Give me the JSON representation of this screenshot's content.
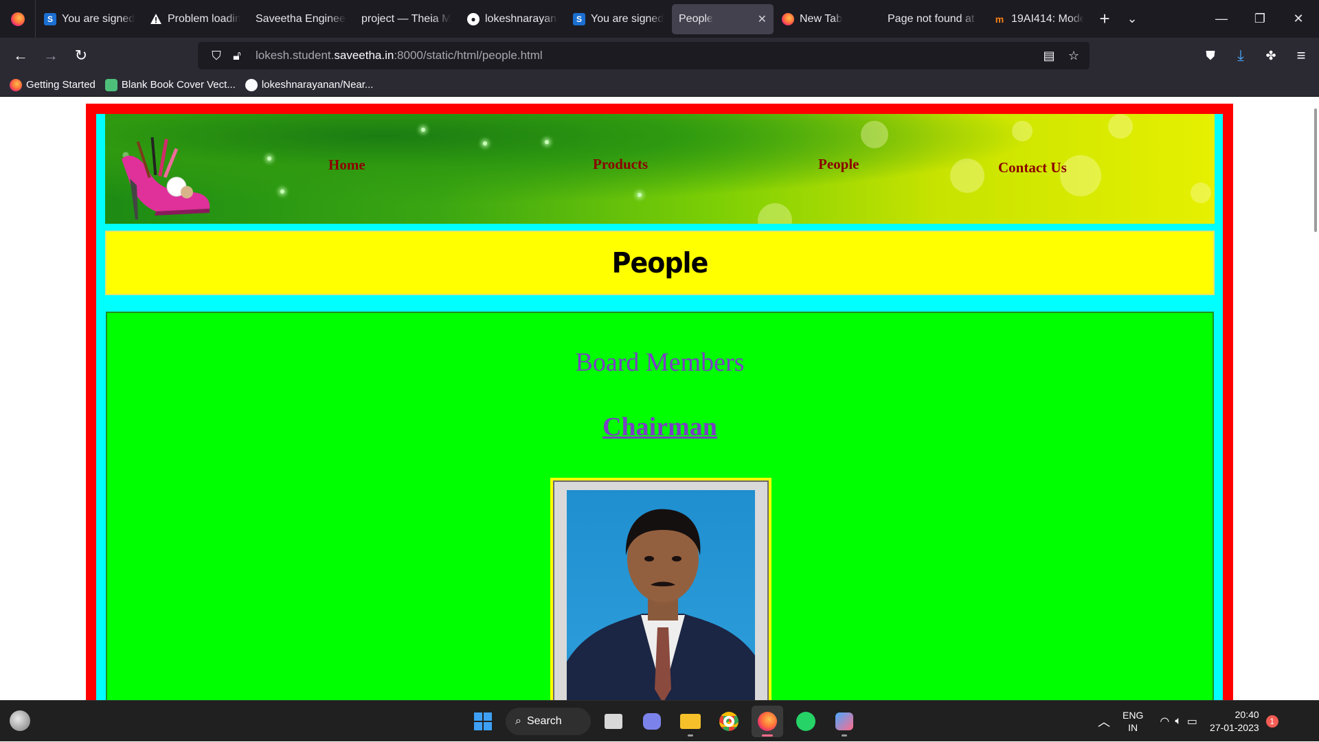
{
  "browser": {
    "tabs": [
      {
        "title": "You are signed",
        "icon": "sololearn-s-icon",
        "icon_color": "#1b6fd1",
        "active": false
      },
      {
        "title": "Problem loadin",
        "icon": "warning-icon",
        "icon_color": "#ffffff",
        "active": false
      },
      {
        "title": "Saveetha Engineeri",
        "icon": "",
        "active": false
      },
      {
        "title": "project — Theia M",
        "icon": "",
        "active": false
      },
      {
        "title": "lokeshnarayana",
        "icon": "github-icon",
        "active": false
      },
      {
        "title": "You are signed",
        "icon": "sololearn-s-icon",
        "icon_color": "#1b6fd1",
        "active": false
      },
      {
        "title": "People",
        "icon": "",
        "active": true
      },
      {
        "title": "New Tab",
        "icon": "firefox-icon",
        "active": false
      },
      {
        "title": "Page not found at /",
        "icon": "",
        "active": false
      },
      {
        "title": "19AI414: Mode",
        "icon": "moodle-icon",
        "active": false
      }
    ],
    "url_prefix": "lokesh.student.",
    "url_domain": "saveetha.in",
    "url_suffix": ":8000/static/html/people.html",
    "bookmarks": [
      {
        "label": "Getting Started",
        "icon": "firefox-icon"
      },
      {
        "label": "Blank Book Cover Vect...",
        "icon": "bookmark-site-icon"
      },
      {
        "label": "lokeshnarayanan/Near...",
        "icon": "github-icon"
      }
    ]
  },
  "page": {
    "nav": {
      "home": "Home",
      "products": "Products",
      "people": "People",
      "contact": "Contact Us"
    },
    "title": "People",
    "board_title": "Board Members",
    "chairman_label": "Chairman",
    "colors": {
      "outer_frame": "#ff0000",
      "inner_frame": "#00ffff",
      "title_band": "#ffff00",
      "panel": "#00ff00",
      "nav_text": "#8b0000",
      "heading_text": "#7a3fc4"
    }
  },
  "taskbar": {
    "search_label": "Search",
    "language": "ENG",
    "region": "IN",
    "time": "20:40",
    "date": "27-01-2023",
    "notification_count": "1"
  }
}
